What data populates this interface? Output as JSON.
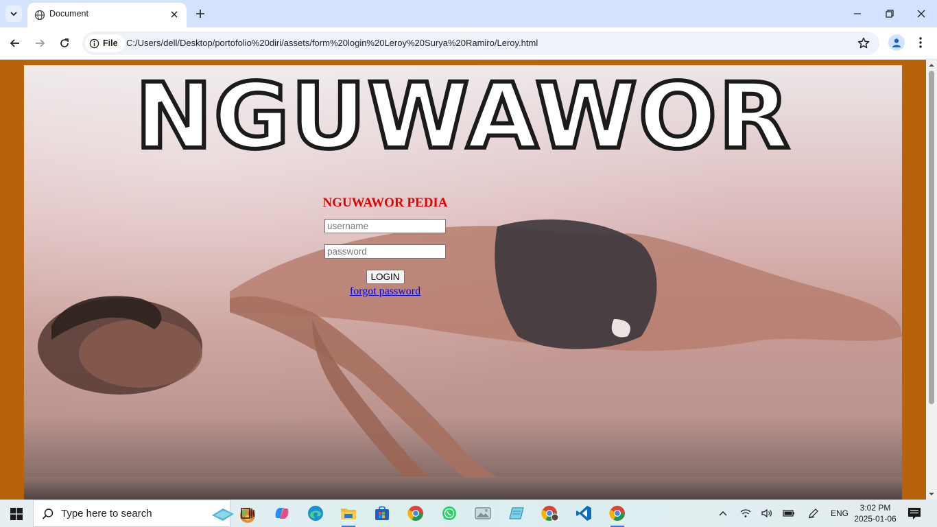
{
  "browser": {
    "tab_title": "Document",
    "address_chip_label": "File",
    "url": "C:/Users/dell/Desktop/portofolio%20diri/assets/form%20login%20Leroy%20Surya%20Ramiro/Leroy.html"
  },
  "page": {
    "background_color": "#b8620a",
    "meme_caption": "NGUWAWOR",
    "login": {
      "heading": "NGUWAWOR PEDIA",
      "heading_color": "#e40000",
      "username_placeholder": "username",
      "password_placeholder": "password",
      "login_button": "LOGIN",
      "forgot_link": "forgot password"
    }
  },
  "taskbar": {
    "search_placeholder": "Type here to search",
    "language": "ENG",
    "time": "3:02 PM",
    "date": "2025-01-06",
    "pinned_icons": [
      "task-view-icon",
      "copilot-icon",
      "edge-icon",
      "file-explorer-icon",
      "microsoft-store-icon",
      "chrome-icon",
      "whatsapp-icon",
      "photos-icon",
      "notepad-icon",
      "chrome-profile-icon",
      "vscode-icon",
      "chrome-active-icon"
    ]
  }
}
